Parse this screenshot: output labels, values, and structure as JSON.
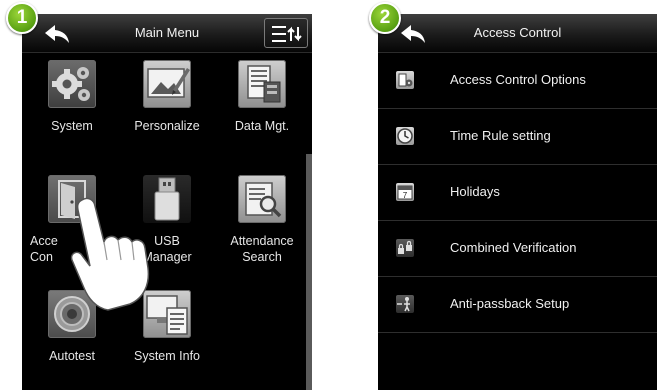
{
  "steps": [
    "1",
    "2"
  ],
  "main_menu": {
    "title": "Main Menu",
    "back_icon": "back-arrow-icon",
    "menu_icon": "sort-menu-icon",
    "items": [
      {
        "label": "System",
        "icon": "gears-icon"
      },
      {
        "label": "Personalize",
        "icon": "picture-pen-icon"
      },
      {
        "label": "Data Mgt.",
        "icon": "data-server-icon"
      },
      {
        "label": "Access Control",
        "label_visible": [
          "Acce",
          "Con"
        ],
        "icon": "door-icon"
      },
      {
        "label": "USB Manager",
        "label_lines": [
          "USB",
          "Manager"
        ],
        "icon": "usb-drive-icon"
      },
      {
        "label": "Attendance Search",
        "label_lines": [
          "Attendance",
          "Search"
        ],
        "icon": "search-record-icon"
      },
      {
        "label": "Autotest",
        "icon": "autotest-icon"
      },
      {
        "label": "System Info",
        "icon": "system-info-icon"
      }
    ],
    "pointer_icon": "tapping-hand-icon"
  },
  "access_control": {
    "title": "Access Control",
    "back_icon": "back-arrow-icon",
    "items": [
      {
        "label": "Access Control Options",
        "icon": "access-options-icon"
      },
      {
        "label": "Time Rule setting",
        "icon": "clock-icon"
      },
      {
        "label": "Holidays",
        "icon": "calendar-icon"
      },
      {
        "label": "Combined Verification",
        "icon": "locks-icon"
      },
      {
        "label": "Anti-passback Setup",
        "icon": "anti-passback-icon"
      }
    ]
  },
  "colors": {
    "screen": "#000000",
    "badge": "#6cb41c",
    "text": "#f0f0f0"
  }
}
